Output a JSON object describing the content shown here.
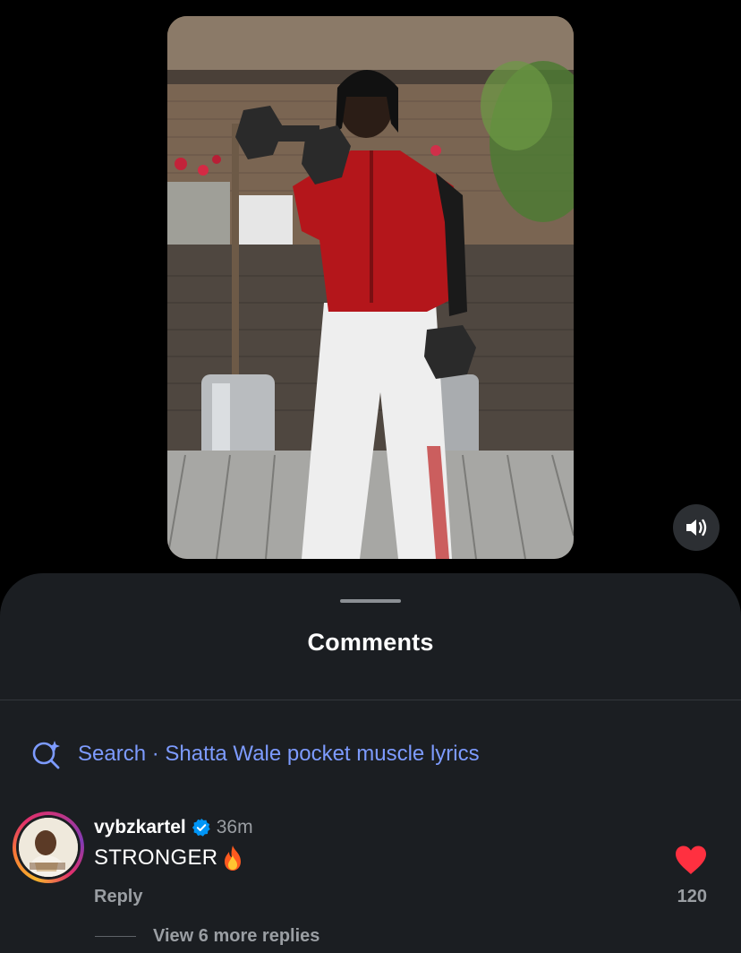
{
  "colors": {
    "sheet_background": "#1b1e22",
    "search_accent": "#7d9bff",
    "like_red": "#ff3040",
    "verified_blue": "#0095f6",
    "muted_text": "#9a9ea3"
  },
  "video": {
    "media": "reel-video",
    "audio_icon": "speaker-volume-icon"
  },
  "comments_sheet": {
    "title": "Comments",
    "search_icon": "sparkle-search-icon",
    "search_text": "Search · Shatta Wale pocket muscle lyrics"
  },
  "comment": {
    "username": "vybzkartel",
    "verified": true,
    "time": "36m",
    "text": "STRONGER",
    "emoji_icon": "fire-icon",
    "reply_label": "Reply",
    "liked": true,
    "like_count": "120",
    "view_replies": "View 6 more replies"
  }
}
